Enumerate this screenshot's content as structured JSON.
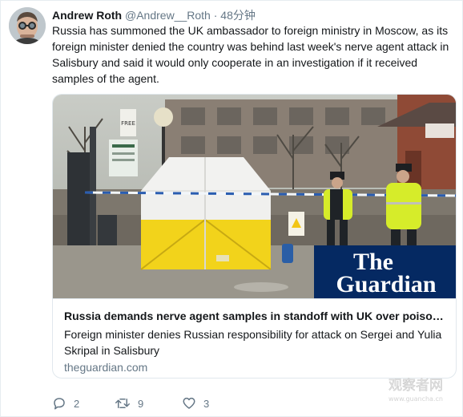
{
  "tweet": {
    "author_name": "Andrew Roth",
    "author_handle": "@Andrew__Roth",
    "separator": "·",
    "time": "48分钟",
    "text": "Russia has summoned the UK ambassador to foreign ministry in Moscow, as its foreign minister denied the country was behind last week's nerve agent attack in Salisbury and said it would only cooperate in an investigation if it received samples of the agent."
  },
  "card": {
    "image_logo_line1": "The",
    "image_logo_line2": "Guardian",
    "image_sign_text": "FREE",
    "title": "Russia demands nerve agent samples in standoff with UK over poisoning",
    "description": "Foreign minister denies Russian responsibility for attack on Sergei and Yulia Skripal in Salisbury",
    "domain": "theguardian.com"
  },
  "actions": {
    "reply_count": "2",
    "retweet_count": "9",
    "like_count": "3"
  },
  "watermark": {
    "line1": "观察者网",
    "line2": "www.guancha.cn"
  },
  "colors": {
    "guardian_bg": "#052962",
    "tent_yellow": "#f2d31b",
    "hivis": "#d6ec2a",
    "muted": "#657786"
  },
  "icons": [
    "avatar-photo",
    "reply-icon",
    "retweet-icon",
    "like-icon"
  ]
}
